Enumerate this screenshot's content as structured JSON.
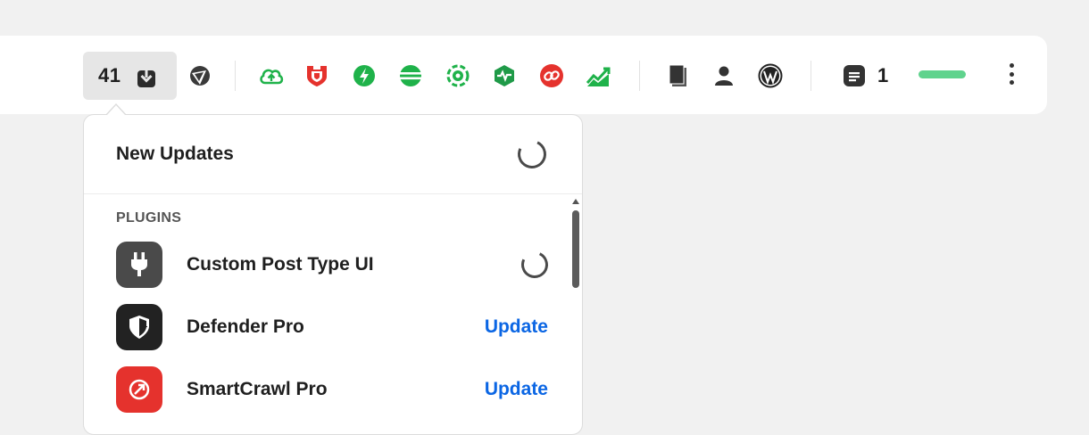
{
  "toolbar": {
    "updates_count": "41",
    "notifications_count": "1",
    "icons": [
      "hosting-icon",
      "hub-cloud-icon",
      "defender-icon",
      "smush-icon",
      "hummingbird-icon",
      "snapshot-icon",
      "uptime-icon",
      "smartcrawl-icon",
      "analytics-icon",
      "pages-icon",
      "user-icon",
      "wordpress-icon",
      "notes-icon",
      "more-icon"
    ],
    "progress_color": "#5fd38d"
  },
  "dropdown": {
    "title": "New Updates",
    "section_label": "PLUGINS",
    "plugins": [
      {
        "name": "Custom Post Type UI",
        "action": "",
        "status": "loading"
      },
      {
        "name": "Defender Pro",
        "action": "Update",
        "status": "available"
      },
      {
        "name": "SmartCrawl Pro",
        "action": "Update",
        "status": "available"
      }
    ]
  },
  "colors": {
    "accent_link": "#0b66e4",
    "green": "#1fb24a",
    "red": "#e5322d"
  }
}
